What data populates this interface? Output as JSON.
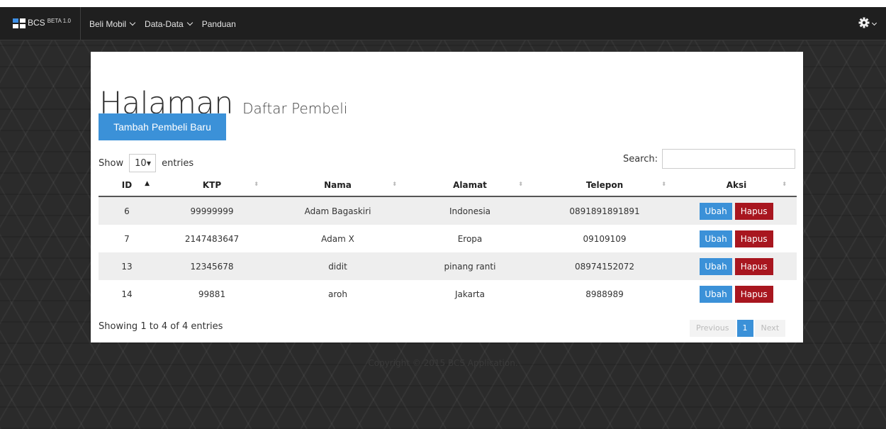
{
  "navbar": {
    "brand": "BCS",
    "brand_version": "BETA 1.0",
    "menu": [
      {
        "label": "Beli Mobil",
        "has_dropdown": true
      },
      {
        "label": "Data-Data",
        "has_dropdown": true
      },
      {
        "label": "Panduan",
        "has_dropdown": false
      }
    ],
    "settings_icon": "gear-icon"
  },
  "page": {
    "title": "Halaman",
    "subtitle": "Daftar Pembeli",
    "add_button": "Tambah Pembeli Baru"
  },
  "table_controls": {
    "show_label": "Show",
    "entries_value": "10",
    "entries_label": "entries",
    "search_label": "Search:",
    "search_value": ""
  },
  "table": {
    "columns": [
      "ID",
      "KTP",
      "Nama",
      "Alamat",
      "Telepon",
      "Aksi"
    ],
    "rows": [
      {
        "id": "6",
        "ktp": "99999999",
        "nama": "Adam Bagaskiri",
        "alamat": "Indonesia",
        "telepon": "0891891891891"
      },
      {
        "id": "7",
        "ktp": "2147483647",
        "nama": "Adam X",
        "alamat": "Eropa",
        "telepon": "09109109"
      },
      {
        "id": "13",
        "ktp": "12345678",
        "nama": "didit",
        "alamat": "pinang ranti",
        "telepon": "08974152072"
      },
      {
        "id": "14",
        "ktp": "99881",
        "nama": "aroh",
        "alamat": "Jakarta",
        "telepon": "8988989"
      }
    ],
    "edit_label": "Ubah",
    "delete_label": "Hapus"
  },
  "pagination": {
    "info": "Showing 1 to 4 of 4 entries",
    "previous": "Previous",
    "current": "1",
    "next": "Next"
  },
  "footer": "Copyright © 2015 BCS Application.",
  "colors": {
    "primary": "#3b91d8",
    "danger": "#a8161f",
    "navbar": "#1f1f1f"
  }
}
